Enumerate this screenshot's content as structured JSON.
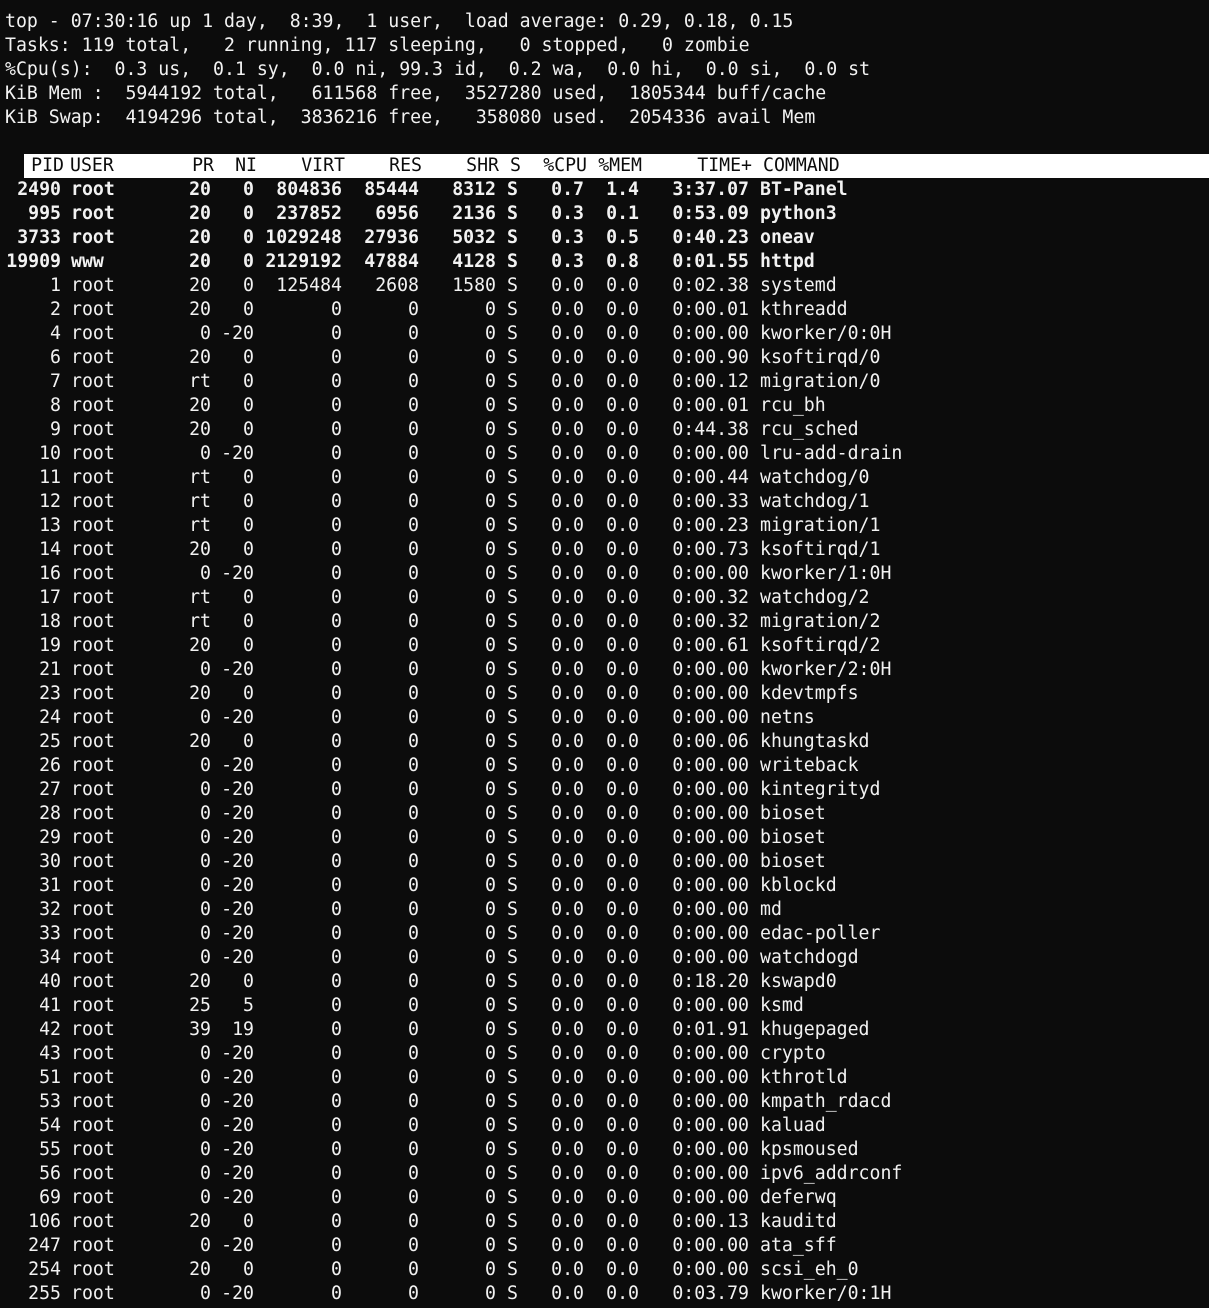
{
  "summary": {
    "line1": "top - 07:30:16 up 1 day,  8:39,  1 user,  load average: 0.29, 0.18, 0.15",
    "line2": "Tasks: 119 total,   2 running, 117 sleeping,   0 stopped,   0 zombie",
    "line3": "%Cpu(s):  0.3 us,  0.1 sy,  0.0 ni, 99.3 id,  0.2 wa,  0.0 hi,  0.0 si,  0.0 st",
    "line4": "KiB Mem :  5944192 total,   611568 free,  3527280 used,  1805344 buff/cache",
    "line5": "KiB Swap:  4194296 total,  3836216 free,   358080 used.  2054336 avail Mem"
  },
  "columns": {
    "pid": "PID",
    "user": "USER",
    "pr": "PR",
    "ni": "NI",
    "virt": "VIRT",
    "res": "RES",
    "shr": "SHR",
    "s": "S",
    "cpu": "%CPU",
    "mem": "%MEM",
    "time": "TIME+",
    "command": "COMMAND"
  },
  "processes": [
    {
      "pid": "2490",
      "user": "root",
      "pr": "20",
      "ni": "0",
      "virt": "804836",
      "res": "85444",
      "shr": "8312",
      "s": "S",
      "cpu": "0.7",
      "mem": "1.4",
      "time": "3:37.07",
      "command": "BT-Panel",
      "bold": true
    },
    {
      "pid": "995",
      "user": "root",
      "pr": "20",
      "ni": "0",
      "virt": "237852",
      "res": "6956",
      "shr": "2136",
      "s": "S",
      "cpu": "0.3",
      "mem": "0.1",
      "time": "0:53.09",
      "command": "python3",
      "bold": true
    },
    {
      "pid": "3733",
      "user": "root",
      "pr": "20",
      "ni": "0",
      "virt": "1029248",
      "res": "27936",
      "shr": "5032",
      "s": "S",
      "cpu": "0.3",
      "mem": "0.5",
      "time": "0:40.23",
      "command": "oneav",
      "bold": true
    },
    {
      "pid": "19909",
      "user": "www",
      "pr": "20",
      "ni": "0",
      "virt": "2129192",
      "res": "47884",
      "shr": "4128",
      "s": "S",
      "cpu": "0.3",
      "mem": "0.8",
      "time": "0:01.55",
      "command": "httpd",
      "bold": true
    },
    {
      "pid": "1",
      "user": "root",
      "pr": "20",
      "ni": "0",
      "virt": "125484",
      "res": "2608",
      "shr": "1580",
      "s": "S",
      "cpu": "0.0",
      "mem": "0.0",
      "time": "0:02.38",
      "command": "systemd"
    },
    {
      "pid": "2",
      "user": "root",
      "pr": "20",
      "ni": "0",
      "virt": "0",
      "res": "0",
      "shr": "0",
      "s": "S",
      "cpu": "0.0",
      "mem": "0.0",
      "time": "0:00.01",
      "command": "kthreadd"
    },
    {
      "pid": "4",
      "user": "root",
      "pr": "0",
      "ni": "-20",
      "virt": "0",
      "res": "0",
      "shr": "0",
      "s": "S",
      "cpu": "0.0",
      "mem": "0.0",
      "time": "0:00.00",
      "command": "kworker/0:0H"
    },
    {
      "pid": "6",
      "user": "root",
      "pr": "20",
      "ni": "0",
      "virt": "0",
      "res": "0",
      "shr": "0",
      "s": "S",
      "cpu": "0.0",
      "mem": "0.0",
      "time": "0:00.90",
      "command": "ksoftirqd/0"
    },
    {
      "pid": "7",
      "user": "root",
      "pr": "rt",
      "ni": "0",
      "virt": "0",
      "res": "0",
      "shr": "0",
      "s": "S",
      "cpu": "0.0",
      "mem": "0.0",
      "time": "0:00.12",
      "command": "migration/0"
    },
    {
      "pid": "8",
      "user": "root",
      "pr": "20",
      "ni": "0",
      "virt": "0",
      "res": "0",
      "shr": "0",
      "s": "S",
      "cpu": "0.0",
      "mem": "0.0",
      "time": "0:00.01",
      "command": "rcu_bh"
    },
    {
      "pid": "9",
      "user": "root",
      "pr": "20",
      "ni": "0",
      "virt": "0",
      "res": "0",
      "shr": "0",
      "s": "S",
      "cpu": "0.0",
      "mem": "0.0",
      "time": "0:44.38",
      "command": "rcu_sched"
    },
    {
      "pid": "10",
      "user": "root",
      "pr": "0",
      "ni": "-20",
      "virt": "0",
      "res": "0",
      "shr": "0",
      "s": "S",
      "cpu": "0.0",
      "mem": "0.0",
      "time": "0:00.00",
      "command": "lru-add-drain"
    },
    {
      "pid": "11",
      "user": "root",
      "pr": "rt",
      "ni": "0",
      "virt": "0",
      "res": "0",
      "shr": "0",
      "s": "S",
      "cpu": "0.0",
      "mem": "0.0",
      "time": "0:00.44",
      "command": "watchdog/0"
    },
    {
      "pid": "12",
      "user": "root",
      "pr": "rt",
      "ni": "0",
      "virt": "0",
      "res": "0",
      "shr": "0",
      "s": "S",
      "cpu": "0.0",
      "mem": "0.0",
      "time": "0:00.33",
      "command": "watchdog/1"
    },
    {
      "pid": "13",
      "user": "root",
      "pr": "rt",
      "ni": "0",
      "virt": "0",
      "res": "0",
      "shr": "0",
      "s": "S",
      "cpu": "0.0",
      "mem": "0.0",
      "time": "0:00.23",
      "command": "migration/1"
    },
    {
      "pid": "14",
      "user": "root",
      "pr": "20",
      "ni": "0",
      "virt": "0",
      "res": "0",
      "shr": "0",
      "s": "S",
      "cpu": "0.0",
      "mem": "0.0",
      "time": "0:00.73",
      "command": "ksoftirqd/1"
    },
    {
      "pid": "16",
      "user": "root",
      "pr": "0",
      "ni": "-20",
      "virt": "0",
      "res": "0",
      "shr": "0",
      "s": "S",
      "cpu": "0.0",
      "mem": "0.0",
      "time": "0:00.00",
      "command": "kworker/1:0H"
    },
    {
      "pid": "17",
      "user": "root",
      "pr": "rt",
      "ni": "0",
      "virt": "0",
      "res": "0",
      "shr": "0",
      "s": "S",
      "cpu": "0.0",
      "mem": "0.0",
      "time": "0:00.32",
      "command": "watchdog/2"
    },
    {
      "pid": "18",
      "user": "root",
      "pr": "rt",
      "ni": "0",
      "virt": "0",
      "res": "0",
      "shr": "0",
      "s": "S",
      "cpu": "0.0",
      "mem": "0.0",
      "time": "0:00.32",
      "command": "migration/2"
    },
    {
      "pid": "19",
      "user": "root",
      "pr": "20",
      "ni": "0",
      "virt": "0",
      "res": "0",
      "shr": "0",
      "s": "S",
      "cpu": "0.0",
      "mem": "0.0",
      "time": "0:00.61",
      "command": "ksoftirqd/2"
    },
    {
      "pid": "21",
      "user": "root",
      "pr": "0",
      "ni": "-20",
      "virt": "0",
      "res": "0",
      "shr": "0",
      "s": "S",
      "cpu": "0.0",
      "mem": "0.0",
      "time": "0:00.00",
      "command": "kworker/2:0H"
    },
    {
      "pid": "23",
      "user": "root",
      "pr": "20",
      "ni": "0",
      "virt": "0",
      "res": "0",
      "shr": "0",
      "s": "S",
      "cpu": "0.0",
      "mem": "0.0",
      "time": "0:00.00",
      "command": "kdevtmpfs"
    },
    {
      "pid": "24",
      "user": "root",
      "pr": "0",
      "ni": "-20",
      "virt": "0",
      "res": "0",
      "shr": "0",
      "s": "S",
      "cpu": "0.0",
      "mem": "0.0",
      "time": "0:00.00",
      "command": "netns"
    },
    {
      "pid": "25",
      "user": "root",
      "pr": "20",
      "ni": "0",
      "virt": "0",
      "res": "0",
      "shr": "0",
      "s": "S",
      "cpu": "0.0",
      "mem": "0.0",
      "time": "0:00.06",
      "command": "khungtaskd"
    },
    {
      "pid": "26",
      "user": "root",
      "pr": "0",
      "ni": "-20",
      "virt": "0",
      "res": "0",
      "shr": "0",
      "s": "S",
      "cpu": "0.0",
      "mem": "0.0",
      "time": "0:00.00",
      "command": "writeback"
    },
    {
      "pid": "27",
      "user": "root",
      "pr": "0",
      "ni": "-20",
      "virt": "0",
      "res": "0",
      "shr": "0",
      "s": "S",
      "cpu": "0.0",
      "mem": "0.0",
      "time": "0:00.00",
      "command": "kintegrityd"
    },
    {
      "pid": "28",
      "user": "root",
      "pr": "0",
      "ni": "-20",
      "virt": "0",
      "res": "0",
      "shr": "0",
      "s": "S",
      "cpu": "0.0",
      "mem": "0.0",
      "time": "0:00.00",
      "command": "bioset"
    },
    {
      "pid": "29",
      "user": "root",
      "pr": "0",
      "ni": "-20",
      "virt": "0",
      "res": "0",
      "shr": "0",
      "s": "S",
      "cpu": "0.0",
      "mem": "0.0",
      "time": "0:00.00",
      "command": "bioset"
    },
    {
      "pid": "30",
      "user": "root",
      "pr": "0",
      "ni": "-20",
      "virt": "0",
      "res": "0",
      "shr": "0",
      "s": "S",
      "cpu": "0.0",
      "mem": "0.0",
      "time": "0:00.00",
      "command": "bioset"
    },
    {
      "pid": "31",
      "user": "root",
      "pr": "0",
      "ni": "-20",
      "virt": "0",
      "res": "0",
      "shr": "0",
      "s": "S",
      "cpu": "0.0",
      "mem": "0.0",
      "time": "0:00.00",
      "command": "kblockd"
    },
    {
      "pid": "32",
      "user": "root",
      "pr": "0",
      "ni": "-20",
      "virt": "0",
      "res": "0",
      "shr": "0",
      "s": "S",
      "cpu": "0.0",
      "mem": "0.0",
      "time": "0:00.00",
      "command": "md"
    },
    {
      "pid": "33",
      "user": "root",
      "pr": "0",
      "ni": "-20",
      "virt": "0",
      "res": "0",
      "shr": "0",
      "s": "S",
      "cpu": "0.0",
      "mem": "0.0",
      "time": "0:00.00",
      "command": "edac-poller"
    },
    {
      "pid": "34",
      "user": "root",
      "pr": "0",
      "ni": "-20",
      "virt": "0",
      "res": "0",
      "shr": "0",
      "s": "S",
      "cpu": "0.0",
      "mem": "0.0",
      "time": "0:00.00",
      "command": "watchdogd"
    },
    {
      "pid": "40",
      "user": "root",
      "pr": "20",
      "ni": "0",
      "virt": "0",
      "res": "0",
      "shr": "0",
      "s": "S",
      "cpu": "0.0",
      "mem": "0.0",
      "time": "0:18.20",
      "command": "kswapd0"
    },
    {
      "pid": "41",
      "user": "root",
      "pr": "25",
      "ni": "5",
      "virt": "0",
      "res": "0",
      "shr": "0",
      "s": "S",
      "cpu": "0.0",
      "mem": "0.0",
      "time": "0:00.00",
      "command": "ksmd"
    },
    {
      "pid": "42",
      "user": "root",
      "pr": "39",
      "ni": "19",
      "virt": "0",
      "res": "0",
      "shr": "0",
      "s": "S",
      "cpu": "0.0",
      "mem": "0.0",
      "time": "0:01.91",
      "command": "khugepaged"
    },
    {
      "pid": "43",
      "user": "root",
      "pr": "0",
      "ni": "-20",
      "virt": "0",
      "res": "0",
      "shr": "0",
      "s": "S",
      "cpu": "0.0",
      "mem": "0.0",
      "time": "0:00.00",
      "command": "crypto"
    },
    {
      "pid": "51",
      "user": "root",
      "pr": "0",
      "ni": "-20",
      "virt": "0",
      "res": "0",
      "shr": "0",
      "s": "S",
      "cpu": "0.0",
      "mem": "0.0",
      "time": "0:00.00",
      "command": "kthrotld"
    },
    {
      "pid": "53",
      "user": "root",
      "pr": "0",
      "ni": "-20",
      "virt": "0",
      "res": "0",
      "shr": "0",
      "s": "S",
      "cpu": "0.0",
      "mem": "0.0",
      "time": "0:00.00",
      "command": "kmpath_rdacd"
    },
    {
      "pid": "54",
      "user": "root",
      "pr": "0",
      "ni": "-20",
      "virt": "0",
      "res": "0",
      "shr": "0",
      "s": "S",
      "cpu": "0.0",
      "mem": "0.0",
      "time": "0:00.00",
      "command": "kaluad"
    },
    {
      "pid": "55",
      "user": "root",
      "pr": "0",
      "ni": "-20",
      "virt": "0",
      "res": "0",
      "shr": "0",
      "s": "S",
      "cpu": "0.0",
      "mem": "0.0",
      "time": "0:00.00",
      "command": "kpsmoused"
    },
    {
      "pid": "56",
      "user": "root",
      "pr": "0",
      "ni": "-20",
      "virt": "0",
      "res": "0",
      "shr": "0",
      "s": "S",
      "cpu": "0.0",
      "mem": "0.0",
      "time": "0:00.00",
      "command": "ipv6_addrconf"
    },
    {
      "pid": "69",
      "user": "root",
      "pr": "0",
      "ni": "-20",
      "virt": "0",
      "res": "0",
      "shr": "0",
      "s": "S",
      "cpu": "0.0",
      "mem": "0.0",
      "time": "0:00.00",
      "command": "deferwq"
    },
    {
      "pid": "106",
      "user": "root",
      "pr": "20",
      "ni": "0",
      "virt": "0",
      "res": "0",
      "shr": "0",
      "s": "S",
      "cpu": "0.0",
      "mem": "0.0",
      "time": "0:00.13",
      "command": "kauditd"
    },
    {
      "pid": "247",
      "user": "root",
      "pr": "0",
      "ni": "-20",
      "virt": "0",
      "res": "0",
      "shr": "0",
      "s": "S",
      "cpu": "0.0",
      "mem": "0.0",
      "time": "0:00.00",
      "command": "ata_sff"
    },
    {
      "pid": "254",
      "user": "root",
      "pr": "20",
      "ni": "0",
      "virt": "0",
      "res": "0",
      "shr": "0",
      "s": "S",
      "cpu": "0.0",
      "mem": "0.0",
      "time": "0:00.00",
      "command": "scsi_eh_0"
    },
    {
      "pid": "255",
      "user": "root",
      "pr": "0",
      "ni": "-20",
      "virt": "0",
      "res": "0",
      "shr": "0",
      "s": "S",
      "cpu": "0.0",
      "mem": "0.0",
      "time": "0:03.79",
      "command": "kworker/0:1H"
    }
  ]
}
